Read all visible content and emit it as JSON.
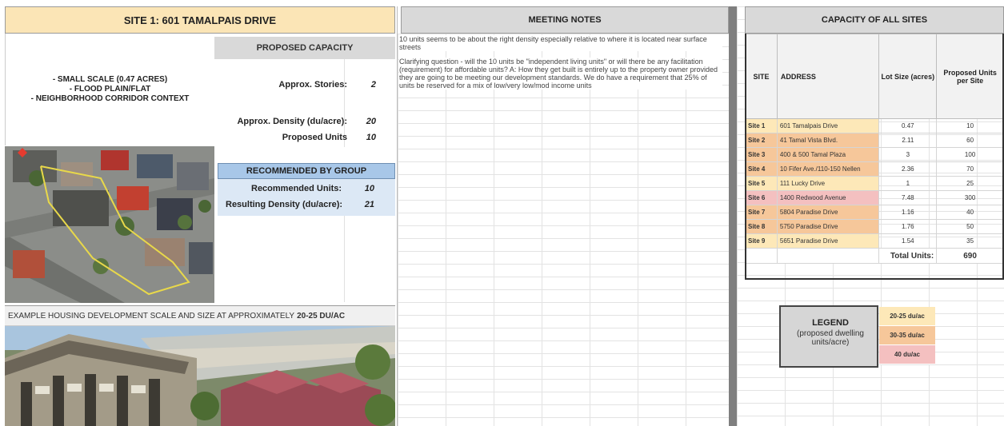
{
  "site": {
    "title": "SITE 1: 601 TAMALPAIS DRIVE",
    "description_lines": [
      "- SMALL SCALE (0.47 ACRES)",
      "- FLOOD PLAIN/FLAT",
      "- NEIGHBORHOOD CORRIDOR CONTEXT"
    ]
  },
  "proposed_capacity": {
    "header": "PROPOSED CAPACITY",
    "stories_label": "Approx. Stories:",
    "stories_value": "2",
    "density_label": "Approx. Density (du/acre):",
    "density_value": "20",
    "units_label": "Proposed Units",
    "units_value": "10"
  },
  "recommended": {
    "header": "RECOMMENDED BY GROUP",
    "units_label": "Recommended Units:",
    "units_value": "10",
    "density_label": "Resulting Density (du/acre):",
    "density_value": "21"
  },
  "example": {
    "label_prefix": "EXAMPLE HOUSING DEVELOPMENT SCALE AND SIZE AT APPROXIMATELY",
    "label_bold": "20-25 DU/AC"
  },
  "notes": {
    "header": "MEETING NOTES",
    "items": [
      "10 units seems to be about the right density especially relative to where it is located near surface streets",
      "Clarifying question - will the 10 units be \"independent living units\" or will there be any facilitation (requirement) for affordable units? A: How they get built is entirely up to the property owner provided they are going to be meeting our development standards. We do have a requirement that 25% of units be reserved for a mix of low/very low/mod income units"
    ]
  },
  "capacity_all": {
    "header": "CAPACITY OF ALL SITES",
    "columns": [
      "SITE",
      "ADDRESS",
      "Lot Size (acres)",
      "Proposed Units per Site"
    ],
    "rows": [
      {
        "site": "Site 1",
        "address": "601 Tamalpais Drive",
        "lot": "0.47",
        "units": "10",
        "band": "20-25"
      },
      {
        "site": "Site 2",
        "address": "41 Tamal Vista Blvd.",
        "lot": "2.11",
        "units": "60",
        "band": "30-35"
      },
      {
        "site": "Site 3",
        "address": "400 & 500 Tamal Plaza",
        "lot": "3",
        "units": "100",
        "band": "30-35"
      },
      {
        "site": "Site 4",
        "address": "10 Fifer Ave./110-150 Nellen",
        "lot": "2.36",
        "units": "70",
        "band": "30-35"
      },
      {
        "site": "Site 5",
        "address": "111 Lucky Drive",
        "lot": "1",
        "units": "25",
        "band": "20-25"
      },
      {
        "site": "Site 6",
        "address": "1400 Redwood Avenue",
        "lot": "7.48",
        "units": "300",
        "band": "40"
      },
      {
        "site": "Site 7",
        "address": "5804 Paradise Drive",
        "lot": "1.16",
        "units": "40",
        "band": "30-35"
      },
      {
        "site": "Site 8",
        "address": "5750 Paradise Drive",
        "lot": "1.76",
        "units": "50",
        "band": "30-35"
      },
      {
        "site": "Site 9",
        "address": "5651 Paradise Drive",
        "lot": "1.54",
        "units": "35",
        "band": "20-25"
      }
    ],
    "total_label": "Total Units:",
    "total_value": "690"
  },
  "legend": {
    "title": "LEGEND",
    "subtitle": "(proposed dwelling units/acre)",
    "items": [
      {
        "label": "20-25 du/ac",
        "color": "#fde8b8"
      },
      {
        "label": "30-35 du/ac",
        "color": "#f6c79a"
      },
      {
        "label": "40 du/ac",
        "color": "#f4c0c0"
      }
    ]
  }
}
